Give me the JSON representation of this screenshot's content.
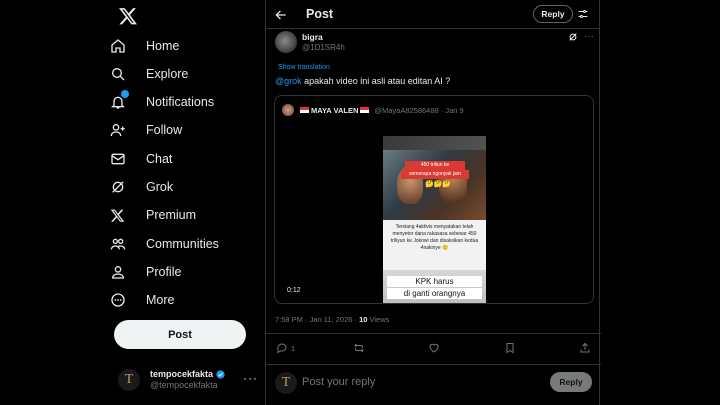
{
  "nav": {
    "items": [
      {
        "label": "Home",
        "icon": "home-icon"
      },
      {
        "label": "Explore",
        "icon": "search-icon"
      },
      {
        "label": "Notifications",
        "icon": "bell-icon"
      },
      {
        "label": "Follow",
        "icon": "follow-icon"
      },
      {
        "label": "Chat",
        "icon": "mail-icon"
      },
      {
        "label": "Grok",
        "icon": "grok-icon"
      },
      {
        "label": "Premium",
        "icon": "x-logo-icon"
      },
      {
        "label": "Communities",
        "icon": "communities-icon"
      },
      {
        "label": "Profile",
        "icon": "profile-icon"
      },
      {
        "label": "More",
        "icon": "more-circle-icon"
      }
    ],
    "post_button": "Post"
  },
  "account": {
    "display_name": "tempocekfakta",
    "username": "@tempocekfakta",
    "avatar_letter": "T"
  },
  "header": {
    "title": "Post",
    "reply_button": "Reply"
  },
  "tweet": {
    "author_name": "bigra",
    "author_handle": "@1D1SR4h",
    "show_translation": "Show translation",
    "mention": "@grok",
    "text": " apakah video ini asli atau editan AI ?",
    "quote": {
      "author_name": "MAYA VALEN",
      "meta": "@MayaA82586488 · Jan 9",
      "video": {
        "red_line1": "450 triliun ke",
        "red_line2": "semerapa ngonyak jam",
        "emoji": "🤔🤔🤔",
        "body": "Tersiang 4aktivis menyatakan telah menyetor dana rakasasa sebesar 450 triliyun ke Jokowi dan disaksikan kedua 4nakinye 🙂",
        "caption1": "KPK harus",
        "caption2": "di ganti orangnya",
        "time": "0:12"
      }
    },
    "timestamp": "7:58 PM · Jan 11, 2026 · ",
    "views_count": "10",
    "views_label": " Views",
    "replies": "1"
  },
  "reply": {
    "placeholder": "Post your reply",
    "button": "Reply",
    "avatar_letter": "T"
  },
  "colors": {
    "background": "#000000",
    "accent": "#1d9bf0",
    "text": "#e7e9ea",
    "muted": "#71767b",
    "border": "#2f3336"
  }
}
